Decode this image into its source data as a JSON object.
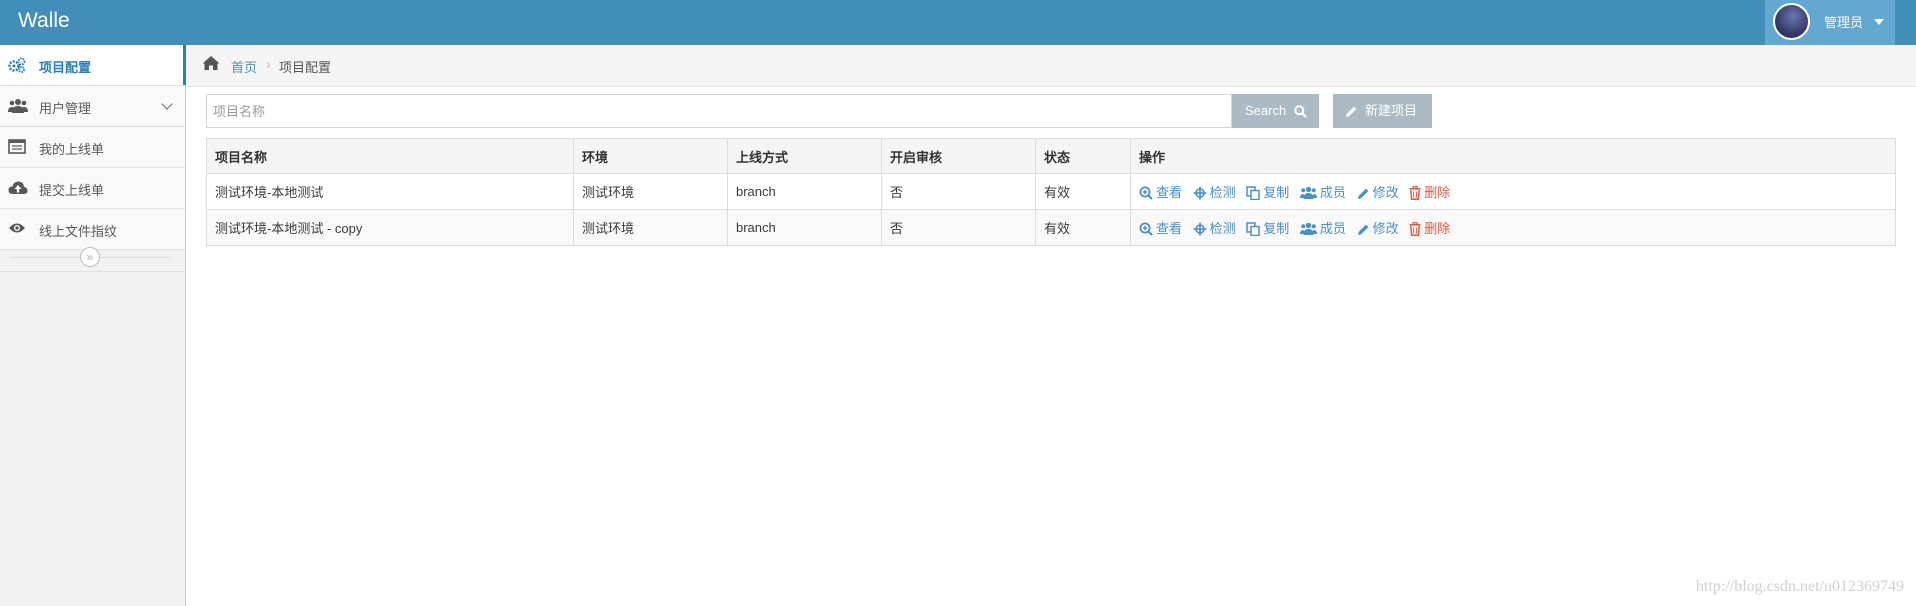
{
  "app": {
    "brand": "Walle"
  },
  "user": {
    "name": "管理员"
  },
  "sidebar": {
    "items": [
      {
        "label": "项目配置",
        "icon": "cogs-icon",
        "active": true
      },
      {
        "label": "用户管理",
        "icon": "users-icon",
        "has_submenu": true
      },
      {
        "label": "我的上线单",
        "icon": "list-window-icon"
      },
      {
        "label": "提交上线单",
        "icon": "cloud-upload-icon"
      },
      {
        "label": "线上文件指纹",
        "icon": "eye-icon"
      }
    ],
    "collapse_glyph": "»"
  },
  "breadcrumb": {
    "home": "首页",
    "current": "项目配置"
  },
  "toolbar": {
    "search_placeholder": "项目名称",
    "search_label": "Search",
    "new_label": "新建项目"
  },
  "table": {
    "headers": [
      "项目名称",
      "环境",
      "上线方式",
      "开启审核",
      "状态",
      "操作"
    ],
    "rows": [
      {
        "name": "测试环境-本地测试",
        "env": "测试环境",
        "method": "branch",
        "audit": "否",
        "status": "有效"
      },
      {
        "name": "测试环境-本地测试 - copy",
        "env": "测试环境",
        "method": "branch",
        "audit": "否",
        "status": "有效"
      }
    ],
    "actions": {
      "view": "查看",
      "detect": "检测",
      "copy": "复制",
      "members": "成员",
      "edit": "修改",
      "delete": "删除"
    }
  },
  "watermark": "http://blog.csdn.net/u012369749",
  "colors": {
    "header": "#438eb9",
    "accent": "#2b7dbc",
    "link": "#4a90c8",
    "danger": "#dd5a43",
    "button": "#abbac3"
  }
}
